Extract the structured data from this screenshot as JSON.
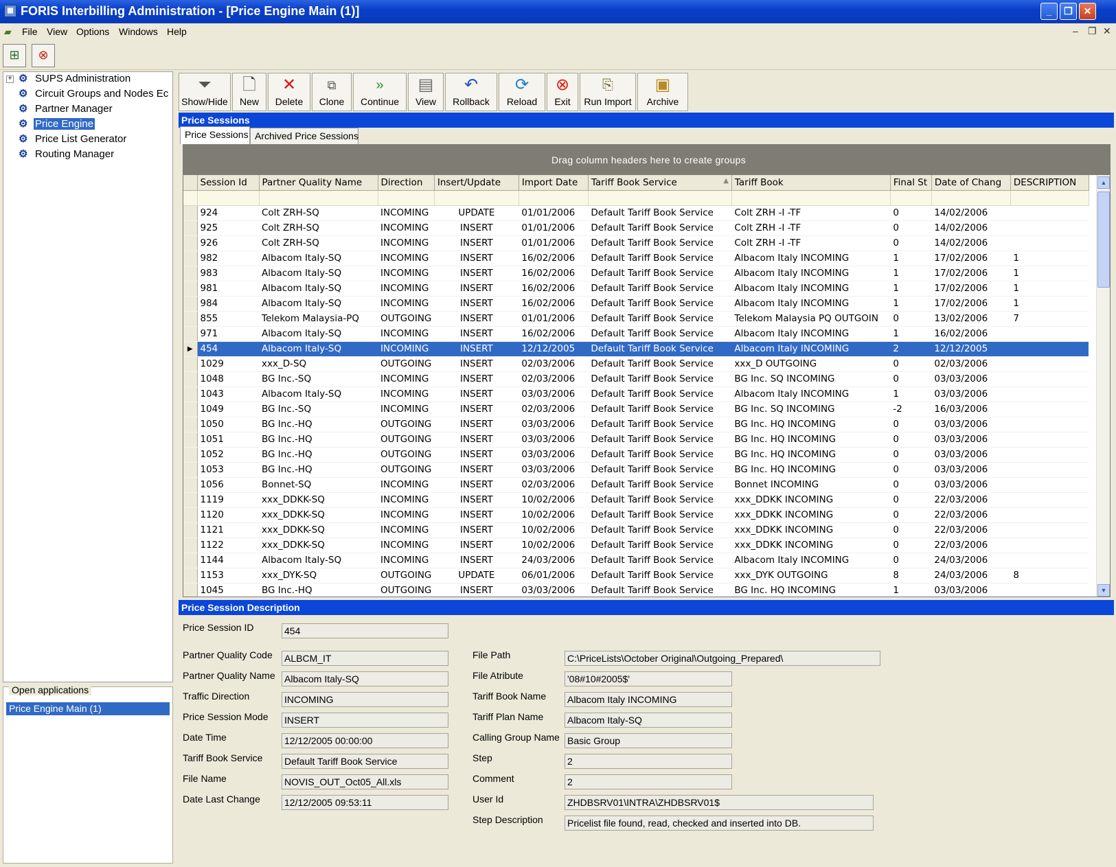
{
  "window": {
    "title": "FORIS Interbilling Administration - [Price Engine Main (1)]",
    "icon": "app-icon"
  },
  "menu": {
    "items": [
      "File",
      "View",
      "Options",
      "Windows",
      "Help"
    ]
  },
  "tree": {
    "items": [
      {
        "label": "SUPS Administration",
        "expandable": true
      },
      {
        "label": "Circuit Groups and Nodes Ec"
      },
      {
        "label": "Partner Manager"
      },
      {
        "label": "Price Engine",
        "selected": true
      },
      {
        "label": "Price List Generator"
      },
      {
        "label": "Routing Manager"
      }
    ]
  },
  "open_apps": {
    "title": "Open applications",
    "item": "Price Engine Main (1)"
  },
  "toolbar": {
    "buttons": [
      {
        "label": "Show/Hide",
        "icon": "funnel-icon"
      },
      {
        "label": "New",
        "icon": "new-document-icon"
      },
      {
        "label": "Delete",
        "icon": "delete-x-icon"
      },
      {
        "label": "Clone",
        "icon": "clone-icon"
      },
      {
        "label": "Continue",
        "icon": "continue-arrows-icon"
      },
      {
        "label": "View",
        "icon": "view-icon"
      },
      {
        "label": "Rollback",
        "icon": "rollback-icon"
      },
      {
        "label": "Reload",
        "icon": "reload-icon"
      },
      {
        "label": "Exit",
        "icon": "exit-icon"
      },
      {
        "label": "Run Import",
        "icon": "run-import-icon"
      },
      {
        "label": "Archive",
        "icon": "archive-box-icon"
      }
    ]
  },
  "sessions_header": "Price Sessions",
  "tabs": [
    "Price Sessions",
    "Archived Price Sessions"
  ],
  "grid": {
    "group_hint": "Drag column headers here to create groups",
    "columns": [
      "Session Id",
      "Partner Quality Name",
      "Direction",
      "Insert/Update",
      "Import Date",
      "Tariff Book Service",
      "Tariff Book",
      "Final St",
      "Date of Chang",
      "DESCRIPTION"
    ],
    "sorted_column": "Tariff Book Service",
    "selected_row": 9,
    "rows": [
      [
        "924",
        "Colt ZRH-SQ",
        "INCOMING",
        "UPDATE",
        "01/01/2006",
        "Default Tariff Book Service",
        "Colt ZRH  -I  -TF",
        "0",
        "14/02/2006",
        ""
      ],
      [
        "925",
        "Colt ZRH-SQ",
        "INCOMING",
        "INSERT",
        "01/01/2006",
        "Default Tariff Book Service",
        "Colt ZRH  -I  -TF",
        "0",
        "14/02/2006",
        ""
      ],
      [
        "926",
        "Colt ZRH-SQ",
        "INCOMING",
        "INSERT",
        "01/01/2006",
        "Default Tariff Book Service",
        "Colt ZRH  -I  -TF",
        "0",
        "14/02/2006",
        ""
      ],
      [
        "982",
        "Albacom Italy-SQ",
        "INCOMING",
        "INSERT",
        "16/02/2006",
        "Default Tariff Book Service",
        "Albacom Italy INCOMING",
        "1",
        "17/02/2006",
        "1"
      ],
      [
        "983",
        "Albacom Italy-SQ",
        "INCOMING",
        "INSERT",
        "16/02/2006",
        "Default Tariff Book Service",
        "Albacom Italy INCOMING",
        "1",
        "17/02/2006",
        "1"
      ],
      [
        "981",
        "Albacom Italy-SQ",
        "INCOMING",
        "INSERT",
        "16/02/2006",
        "Default Tariff Book Service",
        "Albacom Italy INCOMING",
        "1",
        "17/02/2006",
        "1"
      ],
      [
        "984",
        "Albacom Italy-SQ",
        "INCOMING",
        "INSERT",
        "16/02/2006",
        "Default Tariff Book Service",
        "Albacom Italy INCOMING",
        "1",
        "17/02/2006",
        "1"
      ],
      [
        "855",
        "Telekom Malaysia-PQ",
        "OUTGOING",
        "INSERT",
        "01/01/2006",
        "Default Tariff Book Service",
        "Telekom Malaysia PQ OUTGOIN",
        "0",
        "13/02/2006",
        "7"
      ],
      [
        "971",
        "Albacom Italy-SQ",
        "INCOMING",
        "INSERT",
        "16/02/2006",
        "Default Tariff Book Service",
        "Albacom Italy INCOMING",
        "1",
        "16/02/2006",
        ""
      ],
      [
        "454",
        "Albacom Italy-SQ",
        "INCOMING",
        "INSERT",
        "12/12/2005",
        "Default Tariff Book Service",
        "Albacom Italy INCOMING",
        "2",
        "12/12/2005",
        ""
      ],
      [
        "1029",
        "xxx_D-SQ",
        "OUTGOING",
        "INSERT",
        "02/03/2006",
        "Default Tariff Book Service",
        "xxx_D OUTGOING",
        "0",
        "02/03/2006",
        ""
      ],
      [
        "1048",
        "BG Inc.-SQ",
        "INCOMING",
        "INSERT",
        "02/03/2006",
        "Default Tariff Book Service",
        "BG Inc. SQ INCOMING",
        "0",
        "03/03/2006",
        ""
      ],
      [
        "1043",
        "Albacom Italy-SQ",
        "INCOMING",
        "INSERT",
        "03/03/2006",
        "Default Tariff Book Service",
        "Albacom Italy INCOMING",
        "1",
        "03/03/2006",
        ""
      ],
      [
        "1049",
        "BG Inc.-SQ",
        "INCOMING",
        "INSERT",
        "02/03/2006",
        "Default Tariff Book Service",
        "BG Inc. SQ INCOMING",
        "-2",
        "16/03/2006",
        ""
      ],
      [
        "1050",
        "BG Inc.-HQ",
        "OUTGOING",
        "INSERT",
        "03/03/2006",
        "Default Tariff Book Service",
        "BG Inc. HQ INCOMING",
        "0",
        "03/03/2006",
        ""
      ],
      [
        "1051",
        "BG Inc.-HQ",
        "OUTGOING",
        "INSERT",
        "03/03/2006",
        "Default Tariff Book Service",
        "BG Inc. HQ INCOMING",
        "0",
        "03/03/2006",
        ""
      ],
      [
        "1052",
        "BG Inc.-HQ",
        "OUTGOING",
        "INSERT",
        "03/03/2006",
        "Default Tariff Book Service",
        "BG Inc. HQ INCOMING",
        "0",
        "03/03/2006",
        ""
      ],
      [
        "1053",
        "BG Inc.-HQ",
        "OUTGOING",
        "INSERT",
        "03/03/2006",
        "Default Tariff Book Service",
        "BG Inc. HQ INCOMING",
        "0",
        "03/03/2006",
        ""
      ],
      [
        "1056",
        "Bonnet-SQ",
        "INCOMING",
        "INSERT",
        "02/03/2006",
        "Default Tariff Book Service",
        "Bonnet INCOMING",
        "0",
        "03/03/2006",
        ""
      ],
      [
        "1119",
        "xxx_DDKK-SQ",
        "INCOMING",
        "INSERT",
        "10/02/2006",
        "Default Tariff Book Service",
        "xxx_DDKK INCOMING",
        "0",
        "22/03/2006",
        ""
      ],
      [
        "1120",
        "xxx_DDKK-SQ",
        "INCOMING",
        "INSERT",
        "10/02/2006",
        "Default Tariff Book Service",
        "xxx_DDKK INCOMING",
        "0",
        "22/03/2006",
        ""
      ],
      [
        "1121",
        "xxx_DDKK-SQ",
        "INCOMING",
        "INSERT",
        "10/02/2006",
        "Default Tariff Book Service",
        "xxx_DDKK INCOMING",
        "0",
        "22/03/2006",
        ""
      ],
      [
        "1122",
        "xxx_DDKK-SQ",
        "INCOMING",
        "INSERT",
        "10/02/2006",
        "Default Tariff Book Service",
        "xxx_DDKK INCOMING",
        "0",
        "22/03/2006",
        ""
      ],
      [
        "1144",
        "Albacom Italy-SQ",
        "INCOMING",
        "INSERT",
        "24/03/2006",
        "Default Tariff Book Service",
        "Albacom Italy INCOMING",
        "0",
        "24/03/2006",
        ""
      ],
      [
        "1153",
        "xxx_DYK-SQ",
        "OUTGOING",
        "UPDATE",
        "06/01/2006",
        "Default Tariff Book Service",
        "xxx_DYK OUTGOING",
        "8",
        "24/03/2006",
        "8"
      ],
      [
        "1045",
        "BG Inc.-HQ",
        "OUTGOING",
        "INSERT",
        "03/03/2006",
        "Default Tariff Book Service",
        "BG Inc. HQ INCOMING",
        "1",
        "03/03/2006",
        ""
      ]
    ]
  },
  "details": {
    "title": "Price Session Description",
    "left": [
      {
        "label": "Price Session ID",
        "value": "454"
      },
      {
        "label": "Partner Quality Code",
        "value": "ALBCM_IT"
      },
      {
        "label": "Partner Quality Name",
        "value": "Albacom Italy-SQ"
      },
      {
        "label": "Traffic Direction",
        "value": "INCOMING"
      },
      {
        "label": "Price Session Mode",
        "value": "INSERT"
      },
      {
        "label": "Date Time",
        "value": "12/12/2005 00:00:00"
      },
      {
        "label": "Tariff Book Service",
        "value": "Default Tariff Book Service"
      },
      {
        "label": "File Name",
        "value": "NOVIS_OUT_Oct05_All.xls"
      },
      {
        "label": "Date Last Change",
        "value": "12/12/2005 09:53:11"
      }
    ],
    "right": [
      {
        "label": "File Path",
        "value": "C:\\PriceLists\\October Original\\Outgoing_Prepared\\"
      },
      {
        "label": "File Atribute",
        "value": "'08#10#2005$'"
      },
      {
        "label": "Tariff Book Name",
        "value": "Albacom Italy INCOMING"
      },
      {
        "label": "Tariff Plan Name",
        "value": "Albacom Italy-SQ"
      },
      {
        "label": "Calling Group Name",
        "value": "Basic Group"
      },
      {
        "label": "Step",
        "value": "2"
      },
      {
        "label": "Comment",
        "value": "2"
      },
      {
        "label": "User Id",
        "value": "ZHDBSRV01\\INTRA\\ZHDBSRV01$"
      },
      {
        "label": "Step Description",
        "value": "Pricelist file found, read, checked and inserted into DB."
      }
    ]
  }
}
